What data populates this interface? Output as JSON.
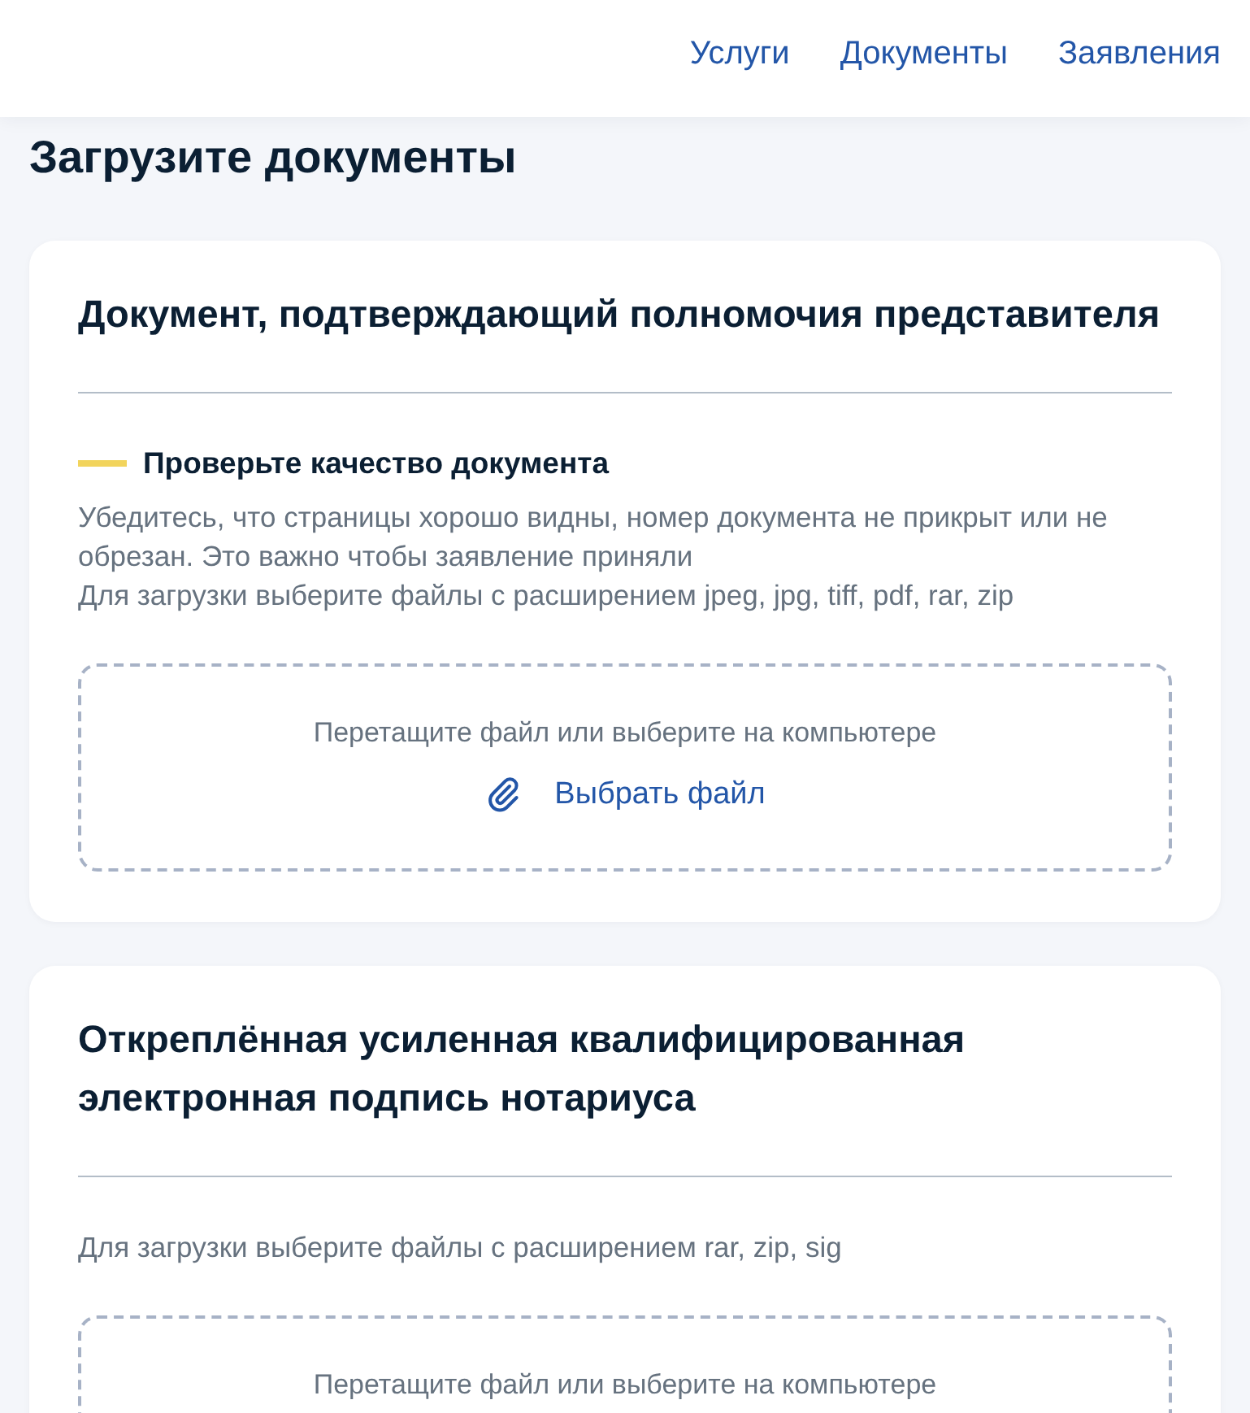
{
  "header": {
    "nav": [
      {
        "label": "Услуги"
      },
      {
        "label": "Документы"
      },
      {
        "label": "Заявления"
      }
    ]
  },
  "page_title": "Загрузите документы",
  "sections": [
    {
      "title": "Документ, подтверждающий полномочия представителя",
      "notice": {
        "heading": "Проверьте качество документа",
        "text": "Убедитесь, что страницы хорошо видны, номер документа не прикрыт или не обрезан. Это важно чтобы заявление приняли"
      },
      "formats": "Для загрузки выберите файлы с расширением jpeg, jpg, tiff, pdf, rar, zip",
      "dropzone": {
        "hint": "Перетащите файл или выберите на компьютере",
        "button": "Выбрать файл"
      }
    },
    {
      "title": "Откреплённая усиленная квалифицированная электронная подпись нотариуса",
      "formats": "Для загрузки выберите файлы с расширением rar, zip, sig",
      "dropzone": {
        "hint": "Перетащите файл или выберите на компьютере"
      }
    }
  ]
}
